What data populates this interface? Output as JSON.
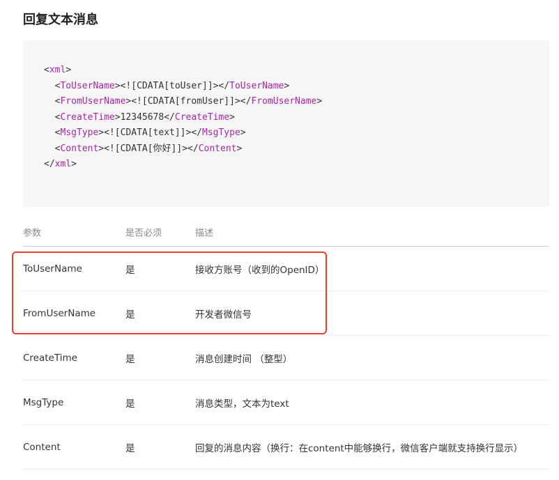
{
  "title": "回复文本消息",
  "code": {
    "lines": [
      {
        "indent": "",
        "open": "xml",
        "content": "",
        "close": ""
      },
      {
        "indent": "  ",
        "open": "ToUserName",
        "content": "<![CDATA[toUser]]>",
        "close": "ToUserName"
      },
      {
        "indent": "  ",
        "open": "FromUserName",
        "content": "<![CDATA[fromUser]]>",
        "close": "FromUserName"
      },
      {
        "indent": "  ",
        "open": "CreateTime",
        "content": "12345678",
        "close": "CreateTime"
      },
      {
        "indent": "  ",
        "open": "MsgType",
        "content": "<![CDATA[text]]>",
        "close": "MsgType"
      },
      {
        "indent": "  ",
        "open": "Content",
        "content": "<![CDATA[你好]]>",
        "close": "Content"
      },
      {
        "indent": "",
        "open": "",
        "content": "",
        "close": "xml"
      }
    ]
  },
  "table": {
    "headers": {
      "param": "参数",
      "required": "是否必须",
      "desc": "描述"
    },
    "rows": [
      {
        "param": "ToUserName",
        "required": "是",
        "desc": "接收方账号（收到的OpenID）"
      },
      {
        "param": "FromUserName",
        "required": "是",
        "desc": "开发者微信号"
      },
      {
        "param": "CreateTime",
        "required": "是",
        "desc": "消息创建时间 （整型）"
      },
      {
        "param": "MsgType",
        "required": "是",
        "desc": "消息类型，文本为text"
      },
      {
        "param": "Content",
        "required": "是",
        "desc": "回复的消息内容（换行：在content中能够换行，微信客户端就支持换行显示）"
      }
    ]
  },
  "colors": {
    "tag": "#a626a4",
    "highlight": "#e8412f",
    "code_bg": "#f6f6f6"
  }
}
